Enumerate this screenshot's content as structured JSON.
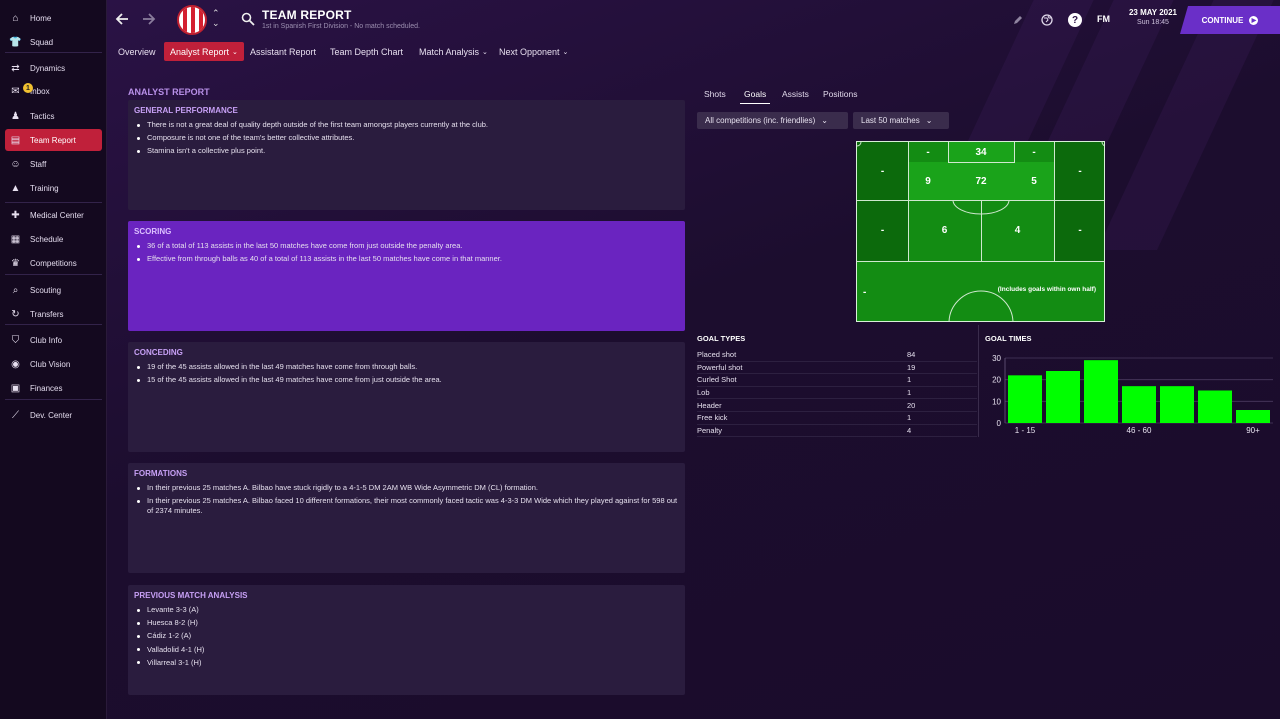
{
  "sidebar": {
    "items": [
      {
        "label": "Home",
        "icon": "home-icon"
      },
      {
        "label": "Squad",
        "icon": "shirt-icon"
      },
      {
        "label": "Dynamics",
        "icon": "dynamics-icon"
      },
      {
        "label": "Inbox",
        "icon": "inbox-icon",
        "badge": "1"
      },
      {
        "label": "Tactics",
        "icon": "tactics-icon"
      },
      {
        "label": "Team Report",
        "icon": "report-icon",
        "active": true
      },
      {
        "label": "Staff",
        "icon": "staff-icon"
      },
      {
        "label": "Training",
        "icon": "training-icon"
      },
      {
        "label": "Medical Center",
        "icon": "medical-icon"
      },
      {
        "label": "Schedule",
        "icon": "calendar-icon"
      },
      {
        "label": "Competitions",
        "icon": "trophy-icon"
      },
      {
        "label": "Scouting",
        "icon": "scouting-icon"
      },
      {
        "label": "Transfers",
        "icon": "transfers-icon"
      },
      {
        "label": "Club Info",
        "icon": "shield-icon"
      },
      {
        "label": "Club Vision",
        "icon": "vision-icon"
      },
      {
        "label": "Finances",
        "icon": "finances-icon"
      },
      {
        "label": "Dev. Center",
        "icon": "dev-center-icon"
      }
    ]
  },
  "header": {
    "title": "TEAM REPORT",
    "subtitle": "1st in Spanish First Division - No match scheduled.",
    "date": "23 MAY 2021",
    "time": "Sun 18:45",
    "fm": "FM",
    "help": "?",
    "continue_label": "CONTINUE"
  },
  "subnav": [
    {
      "label": "Overview"
    },
    {
      "label": "Analyst Report",
      "active": true,
      "caret": "⌄"
    },
    {
      "label": "Assistant Report"
    },
    {
      "label": "Team Depth Chart"
    },
    {
      "label": "Match Analysis",
      "caret": "⌄"
    },
    {
      "label": "Next Opponent",
      "caret": "⌄"
    }
  ],
  "report": {
    "heading": "ANALYST REPORT",
    "sections": [
      {
        "title": "GENERAL PERFORMANCE",
        "items": [
          "There is not a great deal of quality depth outside of the first team amongst players currently at the club.",
          "Composure is not one of the team's better collective attributes.",
          "Stamina isn't a collective plus point."
        ]
      },
      {
        "title": "SCORING",
        "highlight": true,
        "items": [
          "36 of a total of 113 assists in the last 50 matches have come from just outside the penalty area.",
          "Effective from through balls as 40 of a total of 113 assists in the last 50 matches have come in that manner."
        ]
      },
      {
        "title": "CONCEDING",
        "items": [
          "19 of the 45 assists allowed in the last 49 matches have come from through balls.",
          "15 of the 45 assists allowed in the last 49 matches have come from just outside the area."
        ]
      },
      {
        "title": "FORMATIONS",
        "items": [
          "In their previous 25 matches A. Bilbao have stuck rigidly to a 4-1-5 DM 2AM WB Wide Asymmetric DM (CL) formation.",
          "In their previous 25 matches A. Bilbao faced 10 different formations, their most commonly faced tactic was 4-3-3 DM Wide which they played against for 598 out of 2374 minutes."
        ]
      },
      {
        "title": "PREVIOUS MATCH ANALYSIS",
        "items": [
          "Levante 3-3 (A)",
          "Huesca 8-2 (H)",
          "Cádiz 1-2 (A)",
          "Valladolid 4-1 (H)",
          "Villarreal 3-1 (H)"
        ]
      }
    ]
  },
  "stats_tabs": [
    "Shots",
    "Goals",
    "Assists",
    "Positions"
  ],
  "active_stats_tab": "Goals",
  "filters": {
    "competition": "All competitions (inc. friendlies)",
    "range": "Last 50 matches"
  },
  "pitch": {
    "zones": {
      "six_yard_left": "-",
      "six_yard_centre": "34",
      "six_yard_right": "-",
      "box_left": "9",
      "box_centre": "72",
      "box_right": "5",
      "wide_left_box": "-",
      "wide_right_box": "-",
      "outside_left": "-",
      "outside_centre_left": "6",
      "outside_centre_right": "4",
      "outside_right": "-",
      "own_half": "-"
    },
    "own_half_note": "(Includes goals within own half)"
  },
  "goal_types": {
    "title": "GOAL TYPES",
    "rows": [
      {
        "label": "Placed shot",
        "value": "84"
      },
      {
        "label": "Powerful shot",
        "value": "19"
      },
      {
        "label": "Curled Shot",
        "value": "1"
      },
      {
        "label": "Lob",
        "value": "1"
      },
      {
        "label": "Header",
        "value": "20"
      },
      {
        "label": "Free kick",
        "value": "1"
      },
      {
        "label": "Penalty",
        "value": "4"
      }
    ]
  },
  "chart_data": {
    "type": "bar",
    "title": "GOAL TIMES",
    "categories": [
      "1 - 15",
      "16 - 30",
      "31 - 45",
      "46 - 60",
      "61 - 75",
      "76 - 90",
      "90+"
    ],
    "shown_tick_labels": [
      "1 - 15",
      "46 - 60",
      "90+"
    ],
    "values": [
      22,
      24,
      29,
      17,
      17,
      15,
      6
    ],
    "ylim": [
      0,
      30
    ],
    "yticks": [
      0,
      10,
      20,
      30
    ],
    "color": "#00ff00",
    "grid": true
  }
}
